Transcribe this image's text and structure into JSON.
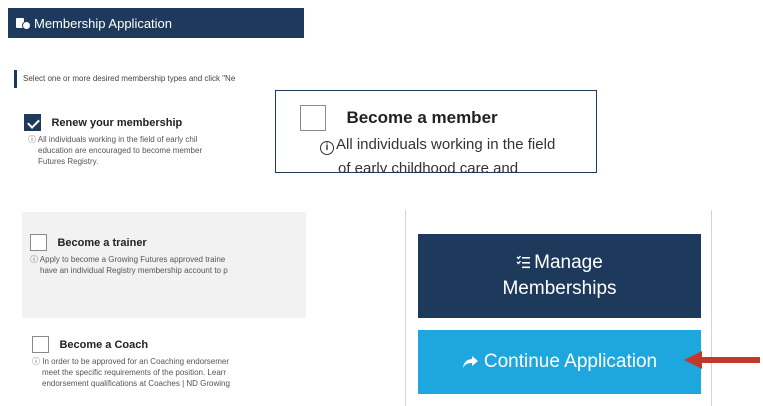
{
  "header": {
    "title": "Membership Application",
    "icon": "membership-card-icon"
  },
  "instruction": "Select one or more desired membership types and click \"Ne",
  "options": [
    {
      "title": "Renew your membership",
      "checked": true,
      "description": [
        "ⓘ All individuals working in the field of early chil",
        "education are encouraged to become member",
        "Futures Registry."
      ]
    },
    {
      "title": "Become a trainer",
      "checked": false,
      "description": [
        "ⓘ Apply to become a Growing Futures approved traine",
        "have an individual Registry membership account to p"
      ]
    },
    {
      "title": "Become a Coach",
      "checked": false,
      "description": [
        "ⓘ In order to be approved for an Coaching endorsemer",
        "meet the specific requirements of the position. Learr",
        "endorsement qualifications at Coaches | ND Growing"
      ]
    }
  ],
  "callout": {
    "title": "Become a member",
    "description_line1": "All individuals working in the field",
    "description_line2": "of early childhood care and",
    "info_glyph": "i"
  },
  "actions": {
    "manage_icon": "list-check-icon",
    "manage_line1": "Manage",
    "manage_line2": "Memberships",
    "continue_icon": "share-arrow-icon",
    "continue_label": "Continue Application"
  },
  "colors": {
    "navy": "#1d3a5c",
    "sky": "#1ea7de",
    "arrow_red": "#c0392b"
  }
}
